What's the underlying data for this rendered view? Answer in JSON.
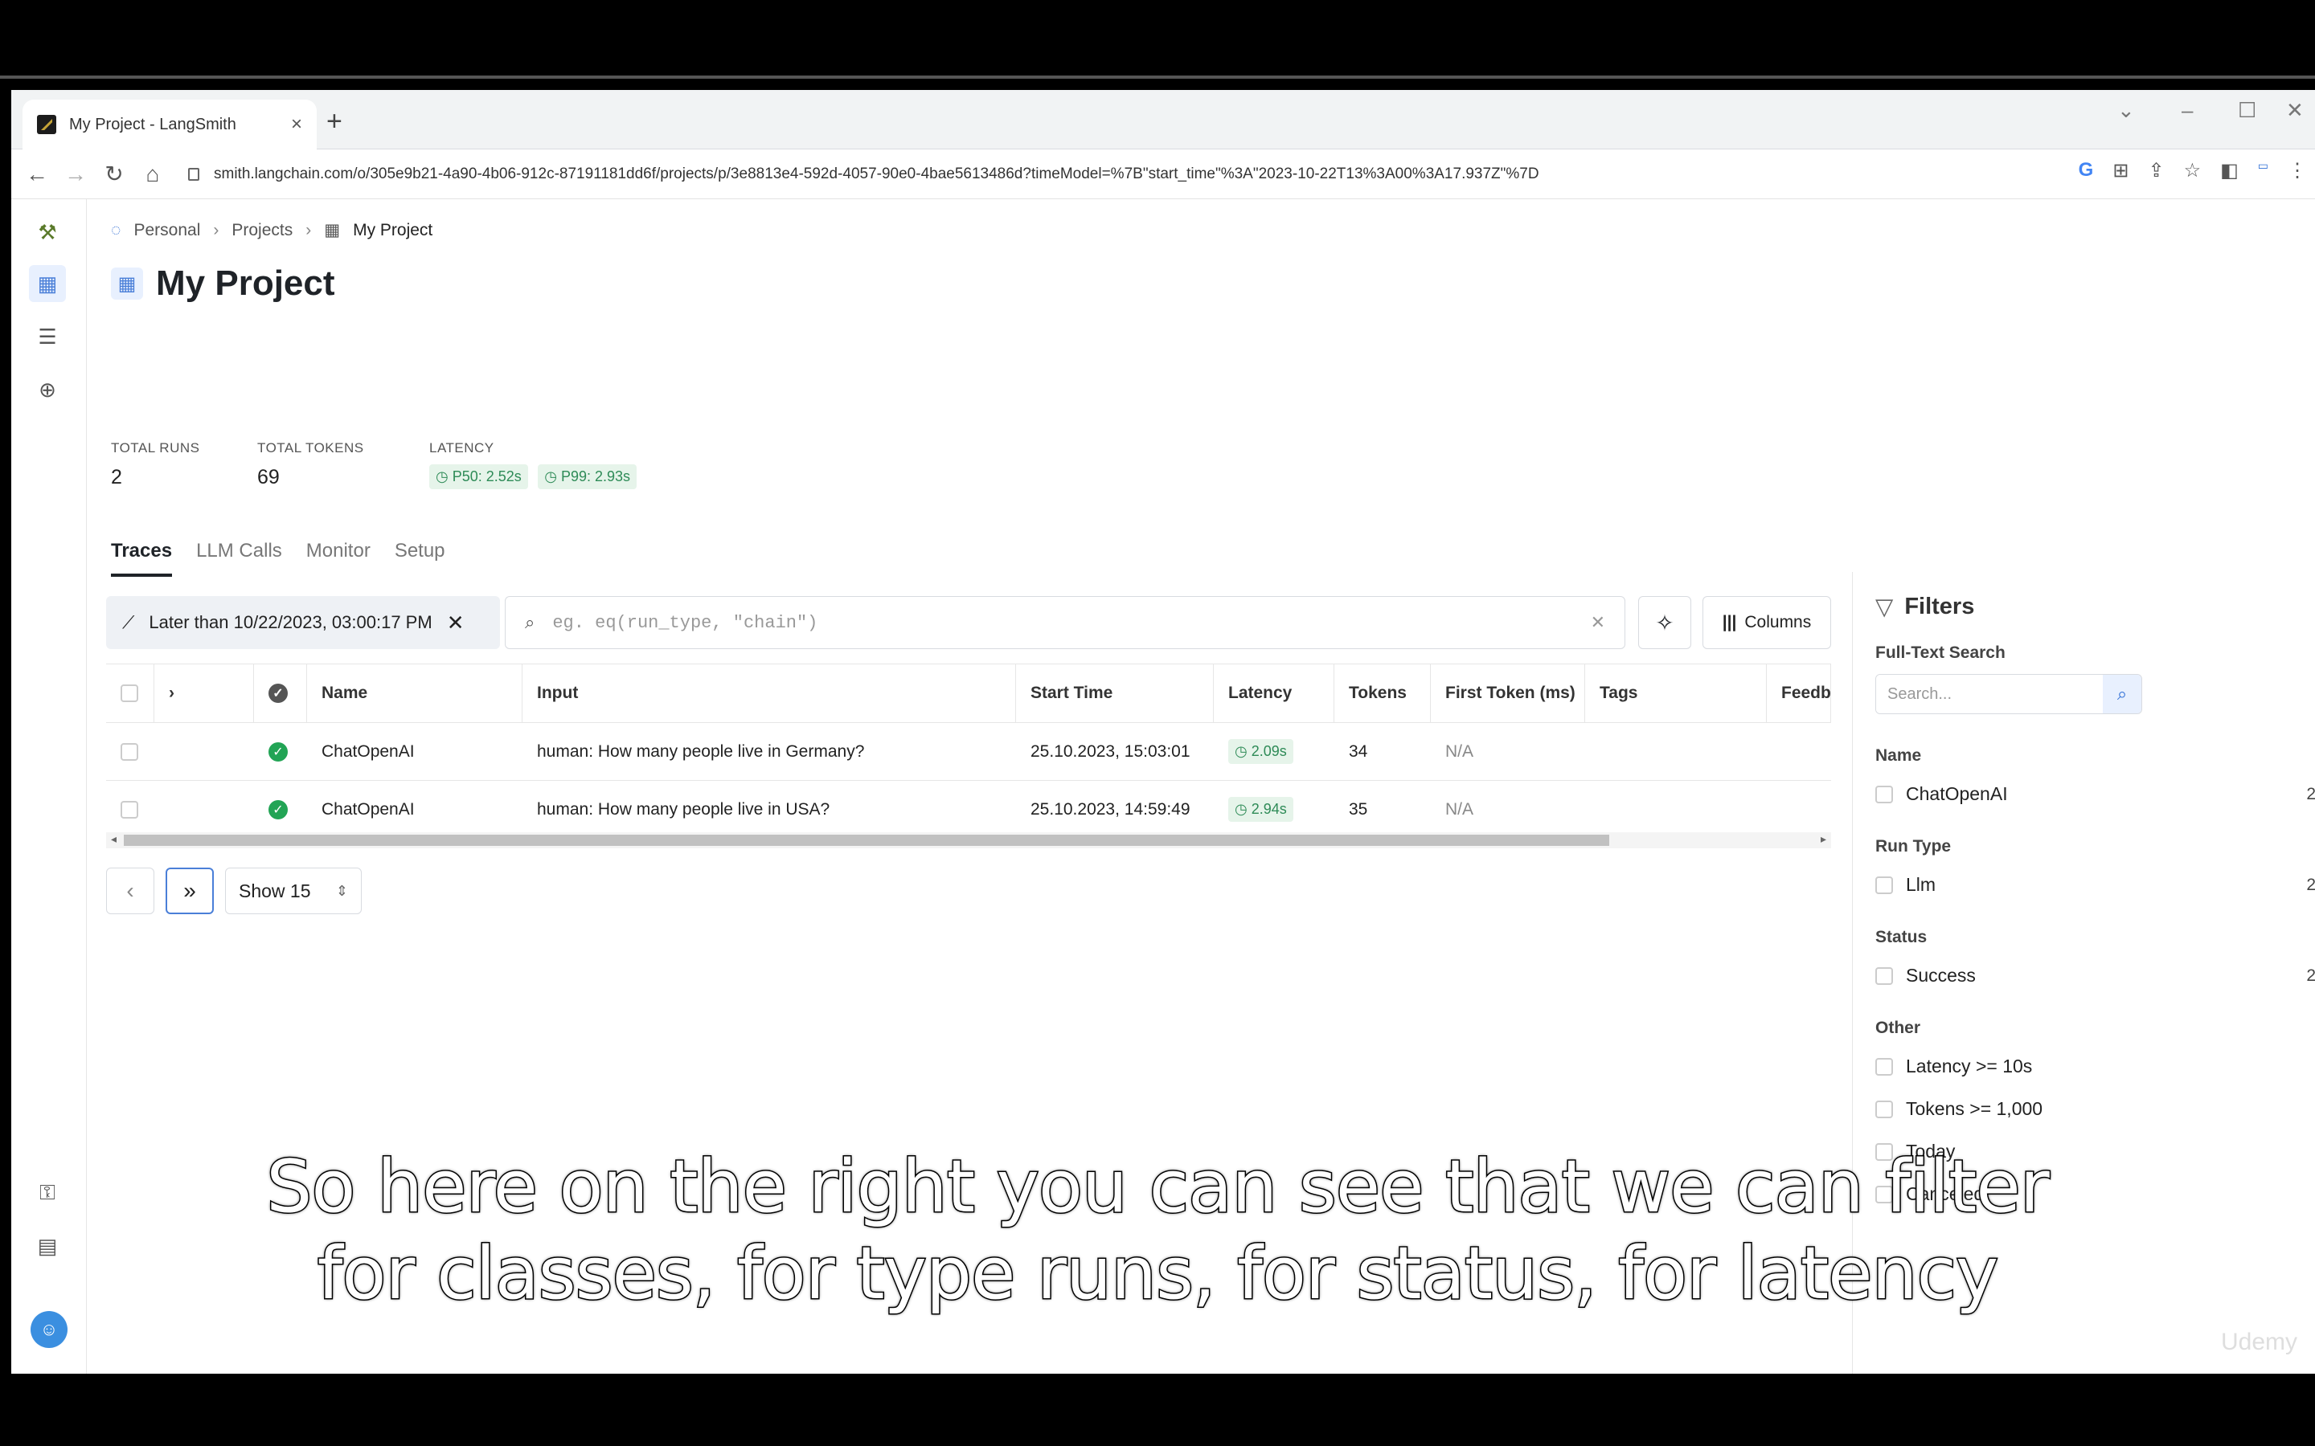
{
  "browser": {
    "tab_title": "My Project - LangSmith",
    "new_tab": "+",
    "url": "smith.langchain.com/o/305e9b21-4a90-4b06-912c-87191181dd6f/projects/p/3e8813e4-592d-4057-90e0-4bae5613486d?timeModel=%7B\"start_time\"%3A\"2023-10-22T13%3A00%3A17.937Z\"%7D"
  },
  "breadcrumb": {
    "items": [
      "Personal",
      "Projects",
      "My Project"
    ]
  },
  "page": {
    "title": "My Project"
  },
  "stats": {
    "total_runs_label": "TOTAL RUNS",
    "total_runs": "2",
    "total_tokens_label": "TOTAL TOKENS",
    "total_tokens": "69",
    "latency_label": "LATENCY",
    "p50": "P50: 2.52s",
    "p99": "P99: 2.93s"
  },
  "tabs": [
    "Traces",
    "LLM Calls",
    "Monitor",
    "Setup"
  ],
  "toolbar": {
    "time_filter": "Later than 10/22/2023, 03:00:17 PM",
    "query_placeholder": "eg. eq(run_type, \"chain\")",
    "columns_label": "Columns"
  },
  "table": {
    "headers": [
      "Name",
      "Input",
      "Start Time",
      "Latency",
      "Tokens",
      "First Token (ms)",
      "Tags",
      "Feedb"
    ],
    "rows": [
      {
        "name": "ChatOpenAI",
        "input": "human: How many people live in Germany?",
        "start": "25.10.2023, 15:03:01",
        "latency": "2.09s",
        "tokens": "34",
        "first_token": "N/A"
      },
      {
        "name": "ChatOpenAI",
        "input": "human: How many people live in USA?",
        "start": "25.10.2023, 14:59:49",
        "latency": "2.94s",
        "tokens": "35",
        "first_token": "N/A"
      }
    ]
  },
  "pager": {
    "show_label": "Show 15"
  },
  "filters": {
    "title": "Filters",
    "fulltext_label": "Full-Text Search",
    "search_placeholder": "Search...",
    "name_label": "Name",
    "name_option": "ChatOpenAI",
    "name_count": "2",
    "runtype_label": "Run Type",
    "runtype_option": "Llm",
    "runtype_count": "2",
    "status_label": "Status",
    "status_option": "Success",
    "status_count": "2",
    "other_label": "Other",
    "other_options": [
      "Latency >= 10s",
      "Tokens >= 1,000",
      "Today",
      "Canceled"
    ]
  },
  "caption": {
    "line1": "So here on the right you can see that we can filter",
    "line2": "for classes, for type runs, for status, for latency"
  },
  "watermark": "Udemy"
}
